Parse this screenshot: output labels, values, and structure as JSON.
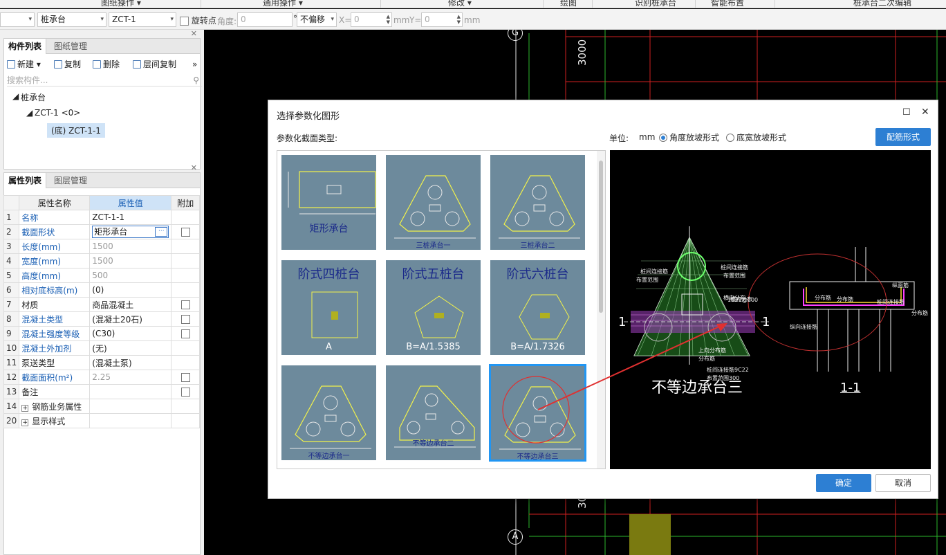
{
  "ribbon": {
    "items": [
      "图纸操作 ▾",
      "通用操作 ▾",
      "修改 ▾",
      "绘图",
      "识别桩承台",
      "智能布置",
      "桩承台二次编辑"
    ]
  },
  "toolbar": {
    "combo_type": "桩承台",
    "combo_member": "ZCT-1",
    "rotate_label": "旋转点",
    "angle_label": "角度:",
    "angle_value": "0",
    "degree": "°",
    "offset_select": "不偏移",
    "x_label": "X=",
    "x_value": "0",
    "mm1": "mm",
    "y_label": "Y=",
    "y_value": "0",
    "mm2": "mm"
  },
  "component_panel": {
    "tabs": [
      "构件列表",
      "图纸管理"
    ],
    "buttons": [
      "新建",
      "复制",
      "删除",
      "层间复制"
    ],
    "more": "»",
    "search_placeholder": "搜索构件...",
    "tree": {
      "root": "桩承台",
      "child": "ZCT-1 <0>",
      "leaf": "(底) ZCT-1-1"
    }
  },
  "property_panel": {
    "tabs": [
      "属性列表",
      "图层管理"
    ],
    "headers": [
      "属性名称",
      "属性值",
      "附加"
    ],
    "rows": [
      {
        "n": "1",
        "name": "名称",
        "value": "ZCT-1-1",
        "check": null
      },
      {
        "n": "2",
        "name": "截面形状",
        "value": "矩形承台",
        "check": false
      },
      {
        "n": "3",
        "name": "长度(mm)",
        "value": "1500",
        "check": null
      },
      {
        "n": "4",
        "name": "宽度(mm)",
        "value": "1500",
        "check": null
      },
      {
        "n": "5",
        "name": "高度(mm)",
        "value": "500",
        "check": null
      },
      {
        "n": "6",
        "name": "相对底标高(m)",
        "value": "(0)",
        "check": null
      },
      {
        "n": "7",
        "name": "材质",
        "value": "商品混凝土",
        "check": false
      },
      {
        "n": "8",
        "name": "混凝土类型",
        "value": "(混凝土20石)",
        "check": false
      },
      {
        "n": "9",
        "name": "混凝土强度等级",
        "value": "(C30)",
        "check": false
      },
      {
        "n": "10",
        "name": "混凝土外加剂",
        "value": "(无)",
        "check": null
      },
      {
        "n": "11",
        "name": "泵送类型",
        "value": "(混凝土泵)",
        "check": null
      },
      {
        "n": "12",
        "name": "截面面积(m²)",
        "value": "2.25",
        "check": false
      },
      {
        "n": "13",
        "name": "备注",
        "value": "",
        "check": false
      },
      {
        "n": "14",
        "name": "钢筋业务属性",
        "value": "",
        "check": null
      },
      {
        "n": "20",
        "name": "显示样式",
        "value": "",
        "check": null
      }
    ]
  },
  "canvas": {
    "axis_top": "G",
    "axis_bottom": "A",
    "dim_top": "3000",
    "dim_bottom": "30"
  },
  "dialog": {
    "title": "选择参数化图形",
    "section_label": "参数化截面类型:",
    "unit_label": "单位:",
    "unit_value": "mm",
    "radio_angle": "角度放坡形式",
    "radio_width": "底宽放坡形式",
    "rebar_button": "配筋形式",
    "ok": "确定",
    "cancel": "取消",
    "shapes": [
      {
        "label": "矩形承台"
      },
      {
        "label": "三桩承台一"
      },
      {
        "label": "三桩承台二"
      },
      {
        "label": "阶式四桩台",
        "sub": "A"
      },
      {
        "label": "阶式五桩台",
        "sub": "B=A/1.5385"
      },
      {
        "label": "阶式六桩台",
        "sub": "B=A/1.7326"
      },
      {
        "label": "不等边承台一"
      },
      {
        "label": "不等边承台二"
      },
      {
        "label": "不等边承台三"
      }
    ],
    "preview": {
      "caption": "不等边承台三",
      "section": "1-1",
      "mark_left": "1",
      "mark_right": "1",
      "labels": [
        "桩间连接筋",
        "布置范围",
        "横向分布",
        "桩间连接筋",
        "布置范围",
        "分布筋",
        "分布筋",
        "纵面筋",
        "桩间连接筋",
        "横向分布",
        "桩间连接筋9C22",
        "布置范围300",
        "1C22@200",
        "上向分布筋",
        "分布筋",
        "纵向连接筋",
        "分布筋"
      ]
    }
  }
}
